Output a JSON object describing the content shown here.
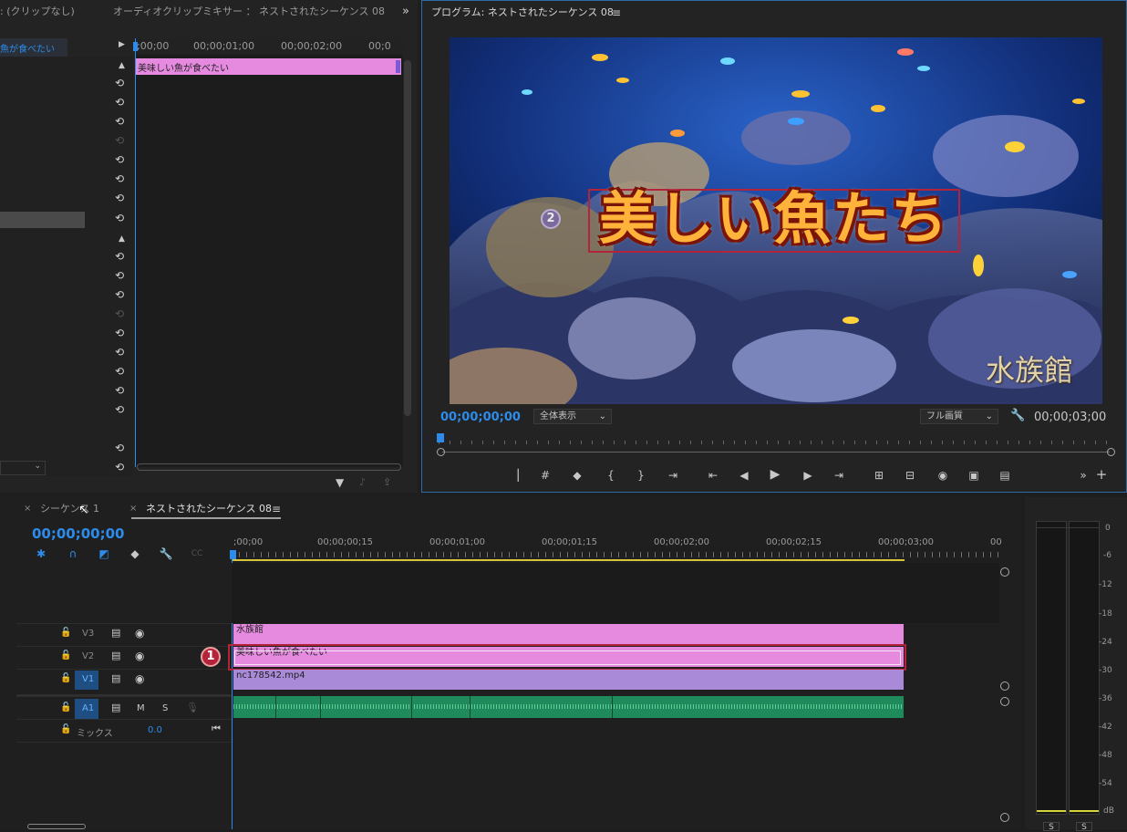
{
  "source_monitor": {
    "tab_left": ": (クリップなし)",
    "tab_mixer": "オーディオクリップミキサー ： ネストされたシーケンス 08",
    "clip_name": "魚が食べたい",
    "clip_bar_label": "美味しい魚が食べたい",
    "ruler": [
      ";00;00",
      "00;00;01;00",
      "00;00;02;00",
      "00;0"
    ]
  },
  "program_monitor": {
    "title": "プログラム: ネストされたシーケンス 08",
    "overlay_title": "美しい魚たち",
    "watermark": "水族館",
    "marker_2": "2",
    "timecode_left": "00;00;00;00",
    "zoom_select": "全体表示",
    "quality_select": "フル画質",
    "timecode_right": "00;00;03;00"
  },
  "timeline": {
    "tab_inactive": "シーケンス 1",
    "tab_active": "ネストされたシーケンス 08",
    "timecode": "00;00;00;00",
    "ruler": [
      ";00;00",
      "00;00;00;15",
      "00;00;01;00",
      "00;00;01;15",
      "00;00;02;00",
      "00;00;02;15",
      "00;00;03;00",
      "00"
    ],
    "tracks": {
      "v3": "V3",
      "v2": "V2",
      "v1": "V1",
      "a1": "A1",
      "a1_m": "M",
      "a1_s": "S",
      "mix_label": "ミックス",
      "mix_value": "0.0"
    },
    "clips": {
      "v3": "水族館",
      "v2": "美味しい魚が食べたい",
      "v1": "nc178542.mp4"
    },
    "marker_1": "1"
  },
  "meter": {
    "labels": [
      "0",
      "-6",
      "-12",
      "-18",
      "-24",
      "-30",
      "-36",
      "-42",
      "-48",
      "-54",
      "dB"
    ],
    "solo_left": "S",
    "solo_right": "S"
  },
  "colors": {
    "accent_blue": "#2d8ceb",
    "clip_pink": "#e68ae0",
    "clip_violet": "#a98ad8",
    "audio_green": "#1f8a5c",
    "highlight_red": "#b3243a"
  }
}
